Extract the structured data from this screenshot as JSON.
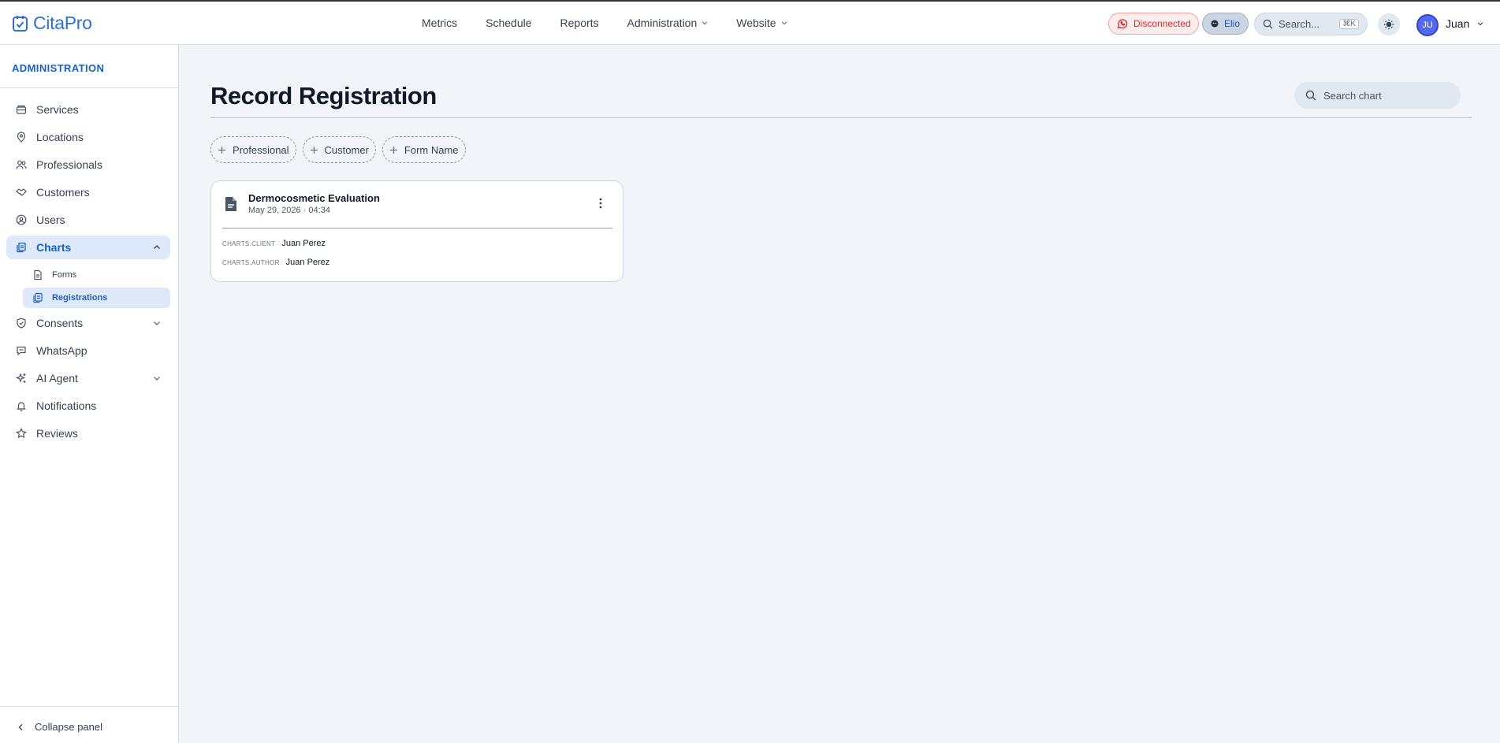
{
  "app": {
    "name": "CitaPro"
  },
  "topnav": {
    "items": [
      {
        "label": "Metrics",
        "dropdown": false
      },
      {
        "label": "Schedule",
        "dropdown": false
      },
      {
        "label": "Reports",
        "dropdown": false
      },
      {
        "label": "Administration",
        "dropdown": true
      },
      {
        "label": "Website",
        "dropdown": true
      }
    ]
  },
  "header": {
    "status_label": "Disconnected",
    "assistant_label": "Elio",
    "search_placeholder": "Search...",
    "search_shortcut": "⌘K",
    "user_initials": "JU",
    "user_name": "Juan"
  },
  "sidebar": {
    "section_title": "ADMINISTRATION",
    "items": [
      {
        "label": "Services",
        "icon": "box-icon"
      },
      {
        "label": "Locations",
        "icon": "map-pin-icon"
      },
      {
        "label": "Professionals",
        "icon": "users-icon"
      },
      {
        "label": "Customers",
        "icon": "handshake-icon"
      },
      {
        "label": "Users",
        "icon": "user-circle-icon"
      },
      {
        "label": "Charts",
        "icon": "files-icon",
        "active": true,
        "expanded": true
      },
      {
        "label": "Consents",
        "icon": "shield-check-icon",
        "expandable": true
      },
      {
        "label": "WhatsApp",
        "icon": "chat-icon"
      },
      {
        "label": "AI Agent",
        "icon": "sparkles-icon",
        "expandable": true
      },
      {
        "label": "Notifications",
        "icon": "bell-icon"
      },
      {
        "label": "Reviews",
        "icon": "star-icon"
      }
    ],
    "chart_subitems": [
      {
        "label": "Forms",
        "icon": "file-icon"
      },
      {
        "label": "Registrations",
        "icon": "files-icon",
        "active": true
      }
    ],
    "collapse_label": "Collapse panel"
  },
  "main": {
    "title": "Record Registration",
    "search_placeholder": "Search chart",
    "filters": [
      "Professional",
      "Customer",
      "Form Name"
    ]
  },
  "records": [
    {
      "title": "Dermocosmetic Evaluation",
      "date": "May 29, 2026 · 04:34",
      "client_key": "CHARTS.CLIENT",
      "client_value": "Juan Perez",
      "author_key": "CHARTS.AUTHOR",
      "author_value": "Juan Perez"
    }
  ],
  "colors": {
    "accent": "#2f6fd6",
    "active_bg": "#deeafb",
    "page_bg": "#f1f5f9",
    "danger": "#d32f2f"
  }
}
